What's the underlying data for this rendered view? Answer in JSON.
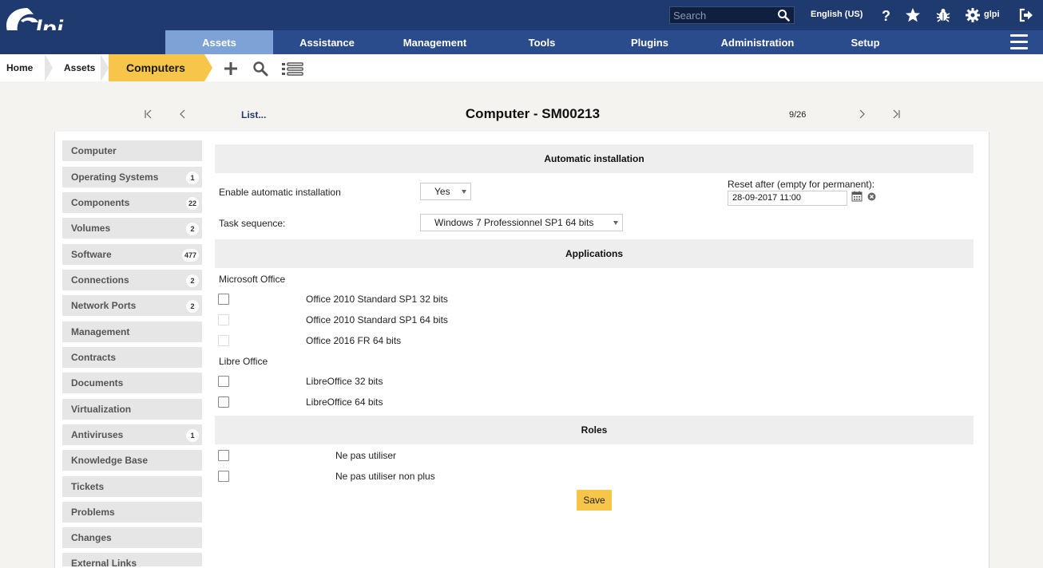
{
  "header": {
    "logo_text": "Glpi",
    "search_placeholder": "Search",
    "language": "English (US)",
    "username": "glpi"
  },
  "menu": {
    "items": [
      {
        "label": "Assets"
      },
      {
        "label": "Assistance"
      },
      {
        "label": "Management"
      },
      {
        "label": "Tools"
      },
      {
        "label": "Plugins"
      },
      {
        "label": "Administration"
      },
      {
        "label": "Setup"
      }
    ],
    "active": "Assets"
  },
  "breadcrumb": {
    "home": "Home",
    "assets": "Assets",
    "current": "Computers"
  },
  "nav": {
    "list_link": "List...",
    "title": "Computer - SM00213",
    "position": "9/26"
  },
  "tabs": [
    {
      "label": "Computer",
      "count": ""
    },
    {
      "label": "Operating Systems",
      "count": "1"
    },
    {
      "label": "Components",
      "count": "22"
    },
    {
      "label": "Volumes",
      "count": "2"
    },
    {
      "label": "Software",
      "count": "477"
    },
    {
      "label": "Connections",
      "count": "2"
    },
    {
      "label": "Network Ports",
      "count": "2"
    },
    {
      "label": "Management",
      "count": ""
    },
    {
      "label": "Contracts",
      "count": ""
    },
    {
      "label": "Documents",
      "count": ""
    },
    {
      "label": "Virtualization",
      "count": ""
    },
    {
      "label": "Antiviruses",
      "count": "1"
    },
    {
      "label": "Knowledge Base",
      "count": ""
    },
    {
      "label": "Tickets",
      "count": ""
    },
    {
      "label": "Problems",
      "count": ""
    },
    {
      "label": "Changes",
      "count": ""
    },
    {
      "label": "External Links",
      "count": ""
    }
  ],
  "auto_install": {
    "heading": "Automatic installation",
    "enable_label": "Enable automatic installation",
    "enable_value": "Yes",
    "reset_label": "Reset after (empty for permanent):",
    "reset_value": "28-09-2017 11:00",
    "task_label": "Task sequence:",
    "task_value": "Windows 7 Professionnel SP1 64 bits"
  },
  "applications": {
    "heading": "Applications",
    "groups": [
      {
        "name": "Microsoft Office",
        "items": [
          {
            "label": "Office 2010 Standard SP1 32 bits",
            "disabled": false
          },
          {
            "label": "Office 2010 Standard SP1 64 bits",
            "disabled": true
          },
          {
            "label": "Office 2016 FR 64 bits",
            "disabled": true
          }
        ]
      },
      {
        "name": "Libre Office",
        "items": [
          {
            "label": "LibreOffice 32 bits",
            "disabled": false
          },
          {
            "label": "LibreOffice 64 bits",
            "disabled": false
          }
        ]
      }
    ]
  },
  "roles": {
    "heading": "Roles",
    "items": [
      {
        "label": "Ne pas utiliser"
      },
      {
        "label": "Ne pas utiliser non plus"
      }
    ]
  },
  "save_label": "Save",
  "colors": {
    "header_bg": "#1f3a6e",
    "menu_bg": "#2b4c8c",
    "menu_active": "#7da3d6",
    "accent": "#f6c54a"
  }
}
